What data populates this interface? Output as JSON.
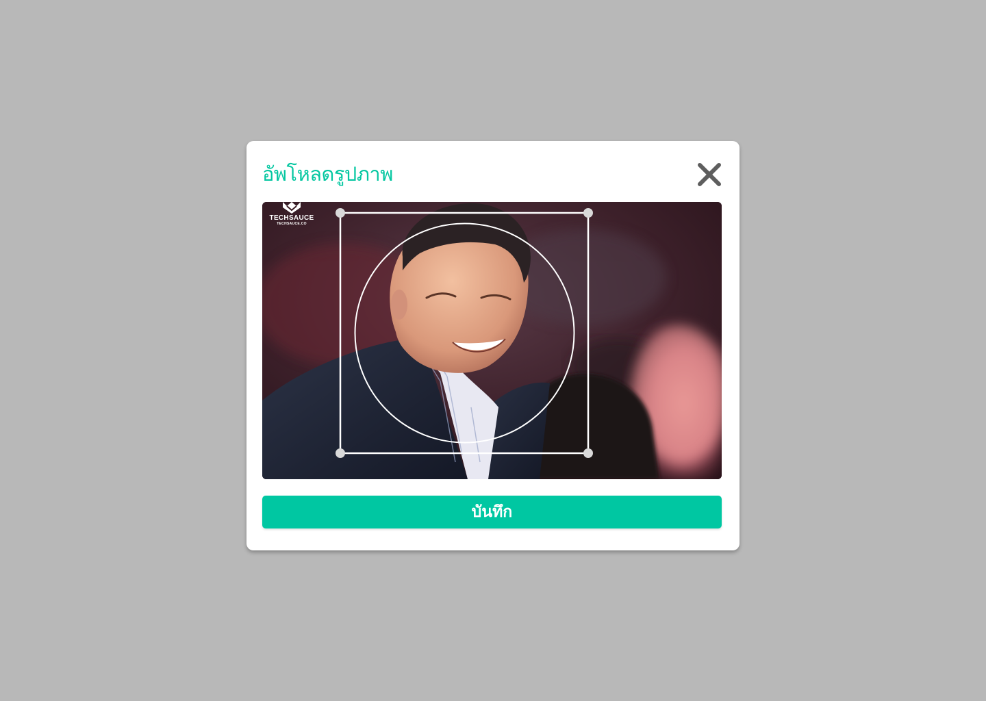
{
  "modal": {
    "title": "อัพโหลดรูปภาพ",
    "close_icon": "close-icon",
    "save_label": "บันทึก"
  },
  "image": {
    "watermark_name": "TECHSAUCE",
    "watermark_url": "TECHSAUCE.CO",
    "watermark_icon": "techsauce-logo"
  },
  "colors": {
    "backdrop": "#b8b8b8",
    "modal_bg": "#ffffff",
    "accent": "#00c7a2",
    "close_icon": "#5e5e5e",
    "crop_handle": "#d9d9d9"
  }
}
